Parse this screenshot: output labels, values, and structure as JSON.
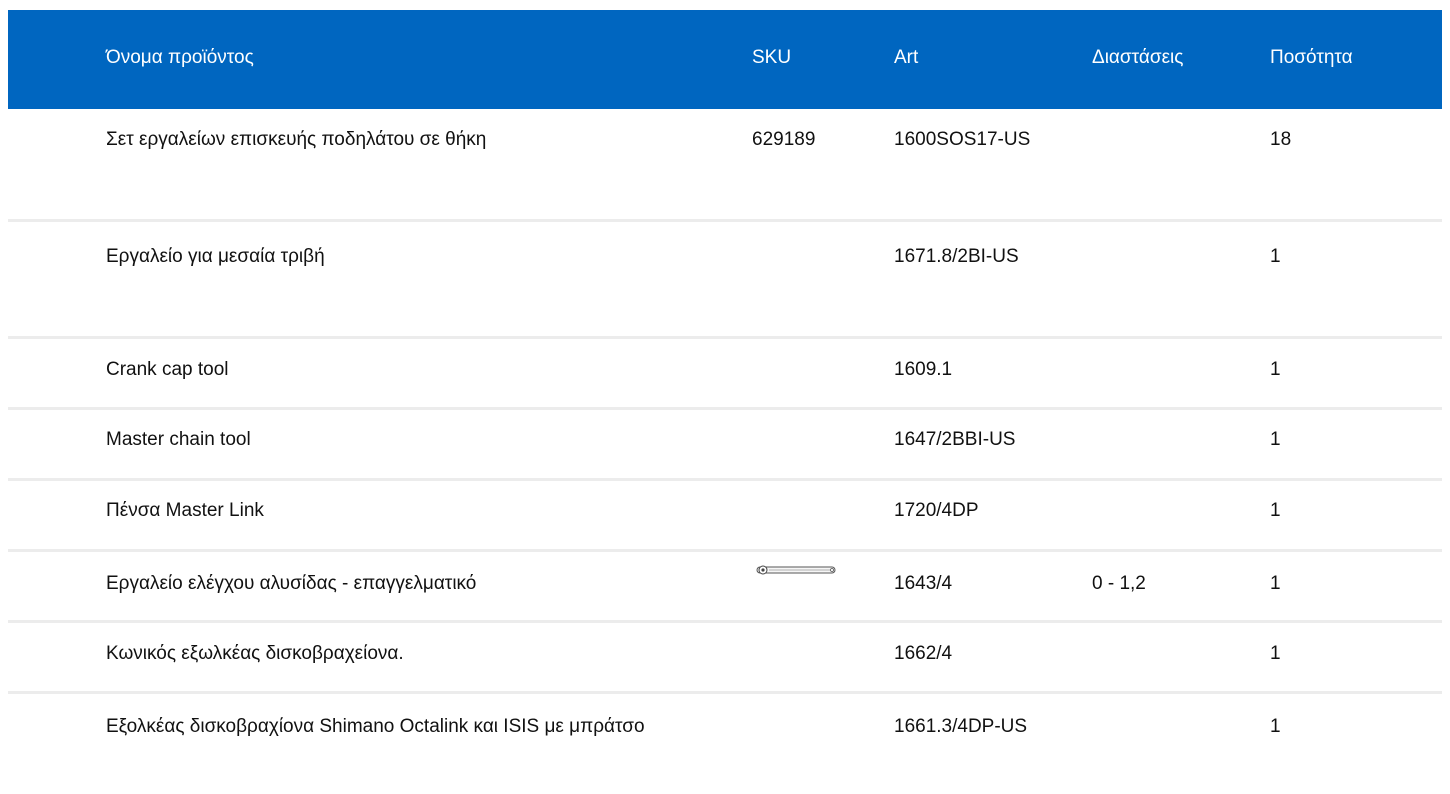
{
  "table": {
    "headers": {
      "name": "Όνομα προϊόντος",
      "sku": "SKU",
      "art": "Art",
      "dimensions": "Διαστάσεις",
      "quantity": "Ποσότητα"
    },
    "rows": [
      {
        "name": "Σετ εργαλείων επισκευής ποδηλάτου σε θήκη",
        "sku": "629189",
        "art": "1600SOS17-US",
        "dimensions": "",
        "quantity": "18"
      },
      {
        "name": "Εργαλείο για μεσαία τριβή",
        "sku": "",
        "art": "1671.8/2BI-US",
        "dimensions": "",
        "quantity": "1"
      },
      {
        "name": "Crank cap tool",
        "sku": "",
        "art": "1609.1",
        "dimensions": "",
        "quantity": "1"
      },
      {
        "name": "Master chain tool",
        "sku": "",
        "art": "1647/2BBI-US",
        "dimensions": "",
        "quantity": "1"
      },
      {
        "name": "Πένσα Master Link",
        "sku": "",
        "art": "1720/4DP",
        "dimensions": "",
        "quantity": "1"
      },
      {
        "name": "Εργαλείο ελέγχου αλυσίδας - επαγγελματικό",
        "sku": "",
        "art": "1643/4",
        "dimensions": "0 - 1,2",
        "quantity": "1"
      },
      {
        "name": "Κωνικός εξωλκέας δισκοβραχείονα.",
        "sku": "",
        "art": "1662/4",
        "dimensions": "",
        "quantity": "1"
      },
      {
        "name": "Εξολκέας δισκοβραχίονα Shimano Octalink και ISIS με μπράτσο",
        "sku": "",
        "art": "1661.3/4DP-US",
        "dimensions": "",
        "quantity": "1"
      }
    ]
  },
  "colors": {
    "header_bg": "#0066c0",
    "header_text": "#ffffff",
    "row_divider": "#ececec"
  },
  "icons": {
    "row_6_image": "chain-checker-tool-image"
  }
}
